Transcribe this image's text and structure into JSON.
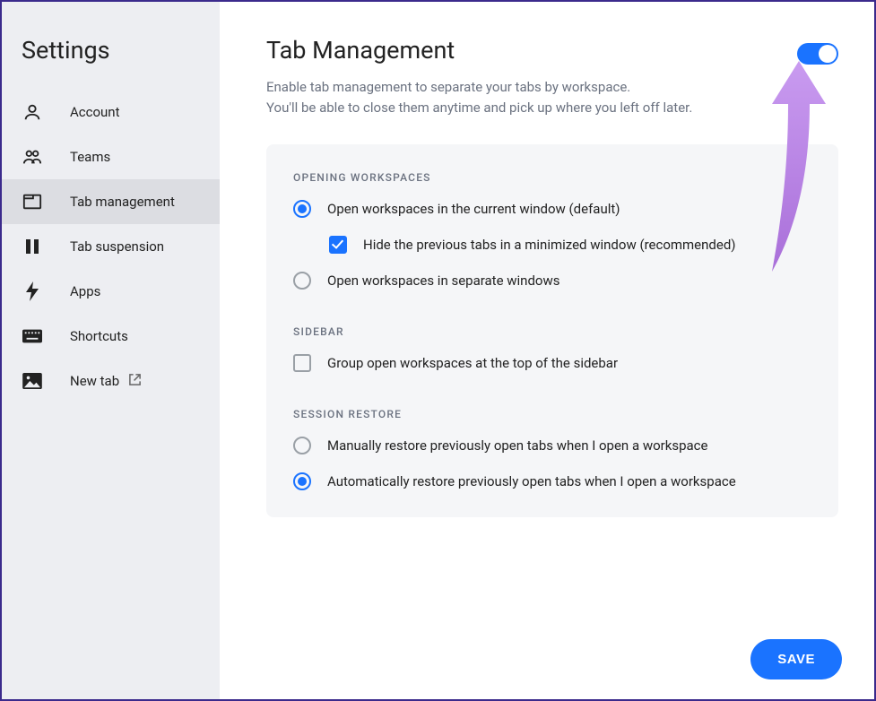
{
  "sidebar": {
    "title": "Settings",
    "items": [
      {
        "label": "Account"
      },
      {
        "label": "Teams"
      },
      {
        "label": "Tab management"
      },
      {
        "label": "Tab suspension"
      },
      {
        "label": "Apps"
      },
      {
        "label": "Shortcuts"
      },
      {
        "label": "New tab"
      }
    ]
  },
  "page": {
    "title": "Tab Management",
    "desc_line1": "Enable tab management to separate your tabs by workspace.",
    "desc_line2": "You'll be able to close them anytime and pick up where you left off later.",
    "toggle_on": true
  },
  "sections": {
    "opening": {
      "label": "OPENING WORKSPACES",
      "opt_current": "Open workspaces in the current window (default)",
      "opt_hide": "Hide the previous tabs in a minimized window (recommended)",
      "opt_separate": "Open workspaces in separate windows"
    },
    "sidebar": {
      "label": "SIDEBAR",
      "opt_group": "Group open workspaces at the top of the sidebar"
    },
    "session": {
      "label": "SESSION RESTORE",
      "opt_manual": "Manually restore previously open tabs when I open a workspace",
      "opt_auto": "Automatically restore previously open tabs when I open a workspace"
    }
  },
  "buttons": {
    "save": "SAVE"
  },
  "colors": {
    "accent": "#1a73ff",
    "arrow": "#b57fe8"
  }
}
